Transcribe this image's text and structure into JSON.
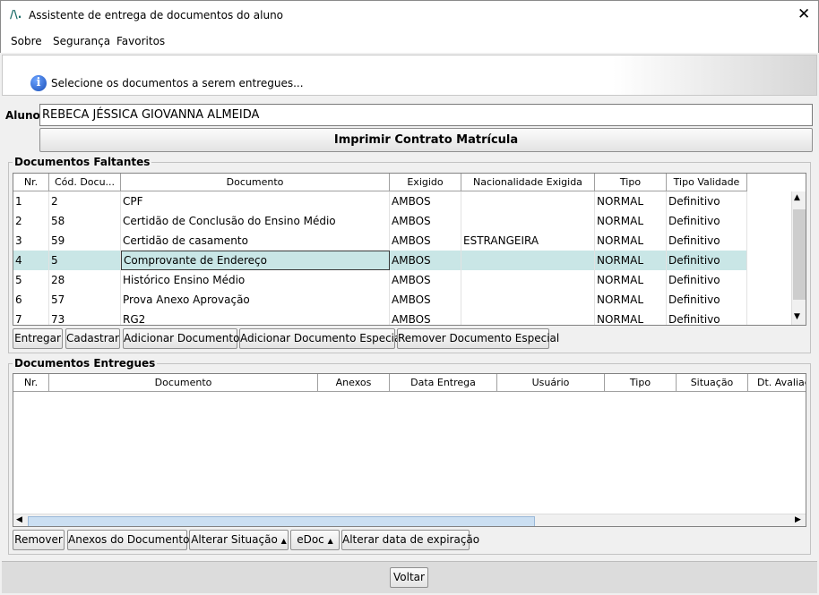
{
  "window": {
    "logo": "/\\.",
    "title": "Assistente de entrega de documentos do aluno",
    "close": "✕"
  },
  "menu": [
    "Sobre",
    "Segurança",
    "Favoritos"
  ],
  "info": {
    "icon": "i",
    "text": "Selecione os documentos a serem entregues..."
  },
  "aluno": {
    "label": "Aluno:",
    "value": "REBECA JÉSSICA GIOVANNA ALMEIDA"
  },
  "print_button": "Imprimir Contrato Matrícula",
  "faltantes": {
    "title": "Documentos Faltantes",
    "columns": [
      "Nr.",
      "Cód. Docu...",
      "Documento",
      "Exigido",
      "Nacionalidade Exigida",
      "Tipo",
      "Tipo Validade"
    ],
    "rows": [
      [
        "1",
        "2",
        "CPF",
        "AMBOS",
        "",
        "NORMAL",
        "Definitivo"
      ],
      [
        "2",
        "58",
        "Certidão de Conclusão do Ensino Médio",
        "AMBOS",
        "",
        "NORMAL",
        "Definitivo"
      ],
      [
        "3",
        "59",
        "Certidão de casamento",
        "AMBOS",
        "ESTRANGEIRA",
        "NORMAL",
        "Definitivo"
      ],
      [
        "4",
        "5",
        "Comprovante de Endereço",
        "AMBOS",
        "",
        "NORMAL",
        "Definitivo"
      ],
      [
        "5",
        "28",
        "Histórico Ensino Médio",
        "AMBOS",
        "",
        "NORMAL",
        "Definitivo"
      ],
      [
        "6",
        "57",
        "Prova Anexo Aprovação",
        "AMBOS",
        "",
        "NORMAL",
        "Definitivo"
      ],
      [
        "7",
        "73",
        "RG2",
        "AMBOS",
        "",
        "NORMAL",
        "Definitivo"
      ]
    ],
    "selected_row": 3,
    "buttons": [
      "Entregar",
      "Cadastrar",
      "Adicionar Documento",
      "Adicionar Documento Especial",
      "Remover Documento Especial"
    ]
  },
  "entregues": {
    "title": "Documentos Entregues",
    "columns": [
      "Nr.",
      "Documento",
      "Anexos",
      "Data Entrega",
      "Usuário",
      "Tipo",
      "Situação",
      "Dt. Avaliaçã"
    ],
    "buttons": [
      "Remover",
      "Anexos do Documento",
      "Alterar Situação",
      "eDoc",
      "Alterar data de expiração"
    ]
  },
  "voltar": "Voltar",
  "colors": {
    "selected_row": "#c9e6e6",
    "logo": "#1f6e6a"
  }
}
